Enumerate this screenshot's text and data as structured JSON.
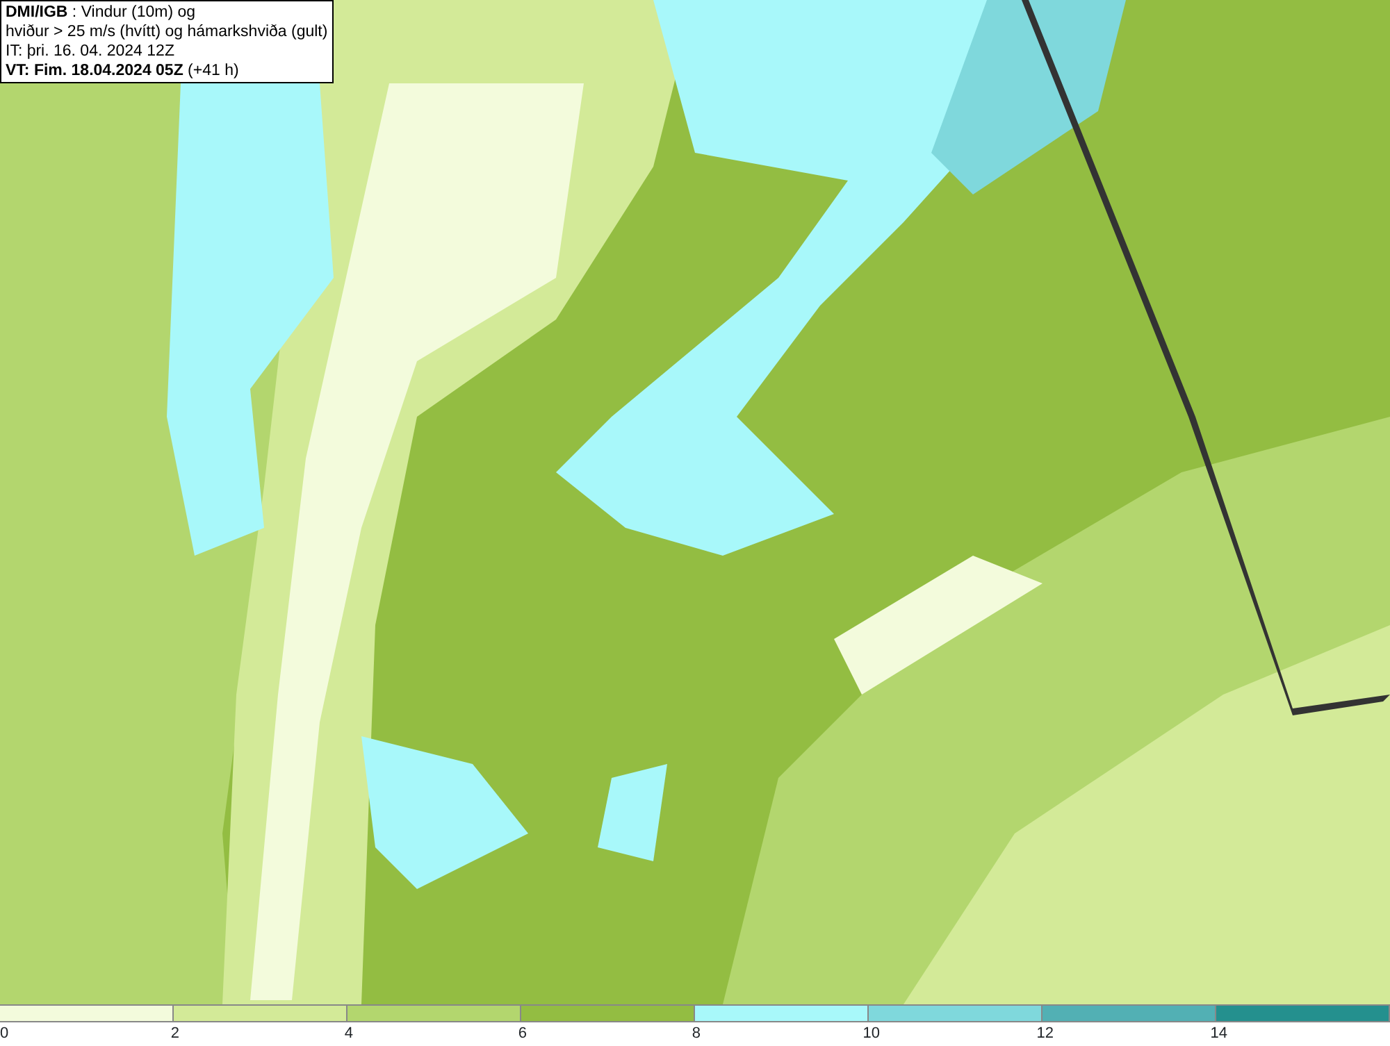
{
  "title_box": {
    "lines": [
      "**DMI/IGB** : Vindur (10m) og",
      "hviður > 25 m/s (hvítt) og hámarkshviða (gult)",
      "IT: þri. 16. 04. 2024 12Z",
      "**VT: Fim. 18.04.2024 05Z** (+41 h)"
    ]
  },
  "legend": {
    "bins": [
      {
        "color": "#f3fbdc",
        "tick": "0"
      },
      {
        "color": "#d3ea98",
        "tick": "2"
      },
      {
        "color": "#b3d66e",
        "tick": "4"
      },
      {
        "color": "#93bd42",
        "tick": "6"
      },
      {
        "color": "#a8f8fa",
        "tick": "8"
      },
      {
        "color": "#7fd8dc",
        "tick": "10"
      },
      {
        "color": "#52b0b4",
        "tick": "12"
      },
      {
        "color": "#24908e",
        "tick": "14"
      }
    ]
  }
}
